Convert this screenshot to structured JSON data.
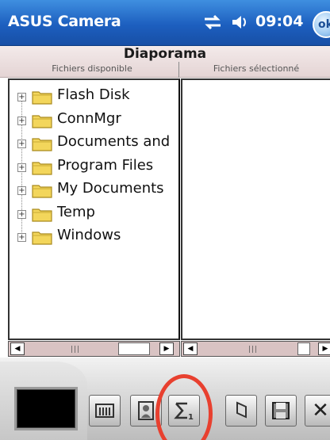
{
  "titlebar": {
    "app_title": "ASUS Camera",
    "time": "09:04",
    "ok_label": "ok",
    "icons": [
      "sync-icon",
      "volume-icon"
    ]
  },
  "header": {
    "title": "Diaporama",
    "col_left": "Fichiers disponible",
    "col_right": "Fichiers sélectionné"
  },
  "tree": {
    "items": [
      {
        "label": "Flash Disk",
        "expander": "+"
      },
      {
        "label": "ConnMgr",
        "expander": "+"
      },
      {
        "label": "Documents and",
        "expander": "+"
      },
      {
        "label": "Program Files",
        "expander": "+"
      },
      {
        "label": "My Documents",
        "expander": "+"
      },
      {
        "label": "Temp",
        "expander": "+"
      },
      {
        "label": "Windows",
        "expander": "+"
      }
    ]
  },
  "toolbar": {
    "buttons": [
      "slideshow-icon",
      "portrait-icon",
      "sequence-icon",
      "rotate-icon",
      "save-icon"
    ],
    "close_label": "✕"
  },
  "colors": {
    "titlebar": "#1d5fbf",
    "highlight": "#e8402f",
    "scrollbar": "#d9c3c3"
  }
}
